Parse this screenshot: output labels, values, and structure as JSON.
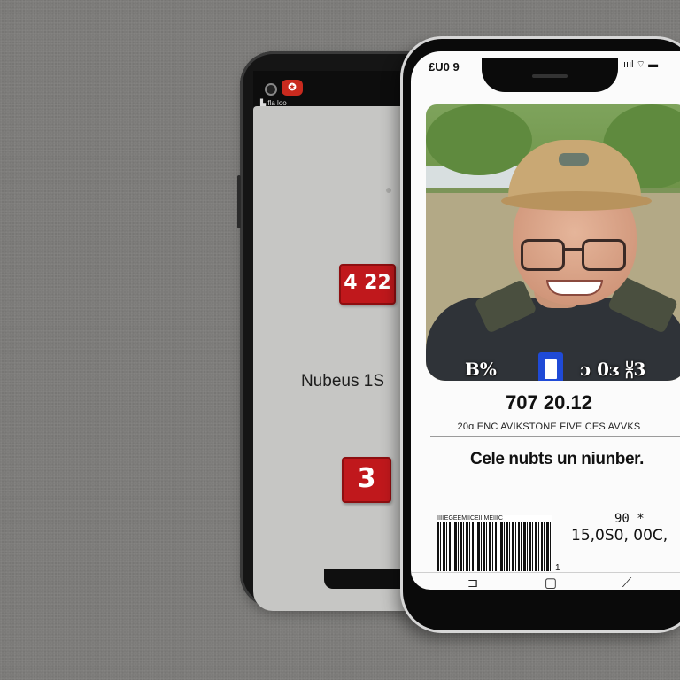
{
  "back_phone": {
    "status_text": "▙ fla loo",
    "badge_top": "4 22",
    "label": "Nubeus 1S",
    "badge_bottom": "3"
  },
  "front_phone": {
    "status_time": "£U0 9",
    "status_icons": "ıııl ⌔ ▬",
    "photo_text_left": "B%",
    "photo_text_right": "ɔ 0ᴣ ⩈3",
    "number": "707 20.12",
    "small_caps": "20ɑ ENC AVIKSTONE FIVE CES AVVKS",
    "caption": "Cele nubts un niunber.",
    "barcode_header": "IIIIEGEEMIICEIIIMEIIIC",
    "barcode_tick": "1",
    "barcode_small": "90 *",
    "barcode_number": "15,0S0, 00C,",
    "nav": {
      "back": "⊐",
      "home": "▢",
      "recent": "⟋"
    }
  },
  "colors": {
    "background": "#7c7b79",
    "badge_red": "#c0181c",
    "id_badge_blue": "#1f4ad6"
  }
}
